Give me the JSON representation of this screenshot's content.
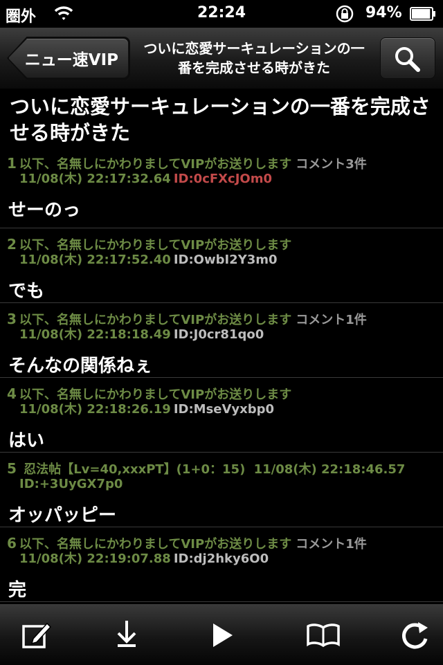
{
  "status_bar": {
    "carrier": "圏外",
    "time": "22:24",
    "battery_percent": "94%",
    "battery_level": 0.94,
    "icons": [
      "wifi-icon",
      "rotation-lock-icon",
      "battery-icon"
    ]
  },
  "nav": {
    "back_label": "ニュー速VIP",
    "title": "ついに恋愛サーキュレーションの一番を完成させる時がきた",
    "search_icon": "search-icon"
  },
  "thread": {
    "title": "ついに恋愛サーキュレーションの一番を完成させる時がきた"
  },
  "posts": [
    {
      "num": "1",
      "name": "以下、名無しにかわりましてVIPがお送りします",
      "comment": "コメント3件",
      "date": "11/08(木) 22:17:32.64",
      "id": "ID:0cFXcJOm0",
      "body": "せーのっ"
    },
    {
      "num": "2",
      "name": "以下、名無しにかわりましてVIPがお送りします",
      "comment": "",
      "date": "11/08(木) 22:17:52.40",
      "id": "ID:OwbI2Y3m0",
      "body": "でも"
    },
    {
      "num": "3",
      "name": "以下、名無しにかわりましてVIPがお送りします",
      "comment": "コメント1件",
      "date": "11/08(木) 22:18:18.49",
      "id": "ID:J0cr81qo0",
      "body": "そんなの関係ねぇ"
    },
    {
      "num": "4",
      "name": "以下、名無しにかわりましてVIPがお送りします",
      "comment": "",
      "date": "11/08(木) 22:18:26.19",
      "id": "ID:MseVyxbp0",
      "body": "はい"
    },
    {
      "num": "5",
      "name": "忍法帖【Lv=40,xxxPT】(1+0：15)",
      "comment": "",
      "date": "11/08(木) 22:18:46.57",
      "id": "ID:+3UyGX7p0",
      "body": "オッパッピー"
    },
    {
      "num": "6",
      "name": "以下、名無しにかわりましてVIPがお送りします",
      "comment": "コメント1件",
      "date": "11/08(木) 22:19:07.88",
      "id": "ID:dj2hky6O0",
      "body": "完"
    }
  ],
  "toolbar": {
    "items": [
      "compose-icon",
      "download-icon",
      "play-icon",
      "bookmarks-icon",
      "reload-icon"
    ]
  },
  "colors": {
    "name_green": "#6d8b45",
    "id_red": "#c34a4a",
    "background": "#000000"
  }
}
